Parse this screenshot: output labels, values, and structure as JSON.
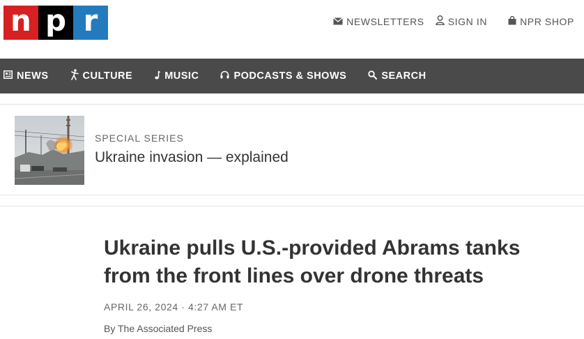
{
  "header": {
    "logo": {
      "letters": [
        "n",
        "p",
        "r"
      ],
      "colors": [
        "#d62021",
        "#000000",
        "#237bbd"
      ]
    },
    "links": {
      "newsletters": {
        "label": "NEWSLETTERS",
        "icon": "envelope-icon"
      },
      "sign_in": {
        "label": "SIGN IN",
        "icon": "user-icon"
      },
      "shop": {
        "label": "NPR SHOP",
        "icon": "shopping-bag-icon"
      }
    }
  },
  "nav": {
    "background": "#4a4a4a",
    "items": [
      {
        "label": "NEWS",
        "icon": "news-icon"
      },
      {
        "label": "CULTURE",
        "icon": "culture-figure-icon"
      },
      {
        "label": "MUSIC",
        "icon": "music-note-icon"
      },
      {
        "label": "PODCASTS & SHOWS",
        "icon": "headphones-icon"
      },
      {
        "label": "SEARCH",
        "icon": "search-icon"
      }
    ]
  },
  "special_series": {
    "kicker": "SPECIAL SERIES",
    "title": "Ukraine invasion — explained"
  },
  "article": {
    "headline": "Ukraine pulls U.S.-provided Abrams tanks from the front lines over drone threats",
    "date": "APRIL 26, 2024 · 4:27 AM ET",
    "byline_prefix": "By",
    "author": "The Associated Press"
  }
}
